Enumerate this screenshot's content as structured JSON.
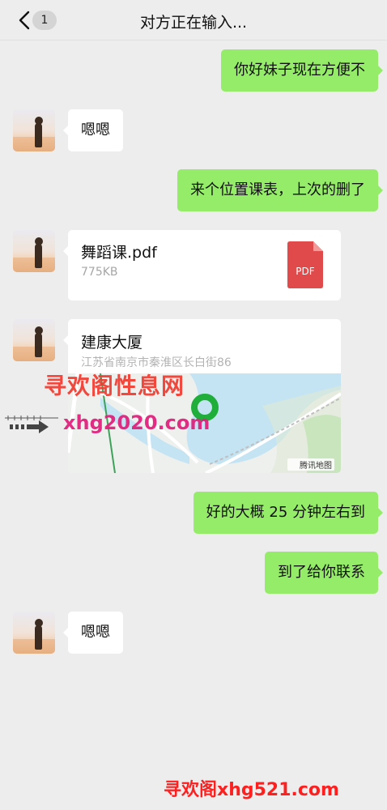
{
  "header": {
    "title": "对方正在输入...",
    "unread_count": "1"
  },
  "messages": [
    {
      "side": "right",
      "text": "你好妹子现在方便不"
    },
    {
      "side": "left",
      "text": "嗯嗯"
    },
    {
      "side": "right",
      "text": "来个位置课表，上次的删了"
    },
    {
      "side": "left",
      "type": "file",
      "name": "舞蹈课.pdf",
      "size": "775KB",
      "icon_label": "PDF"
    },
    {
      "side": "left",
      "type": "location",
      "name": "建康大厦",
      "address": "江苏省南京市秦淮区长白街86",
      "map_brand": "腾讯地图"
    },
    {
      "side": "right",
      "text": "好的大概 25 分钟左右到"
    },
    {
      "side": "right",
      "text": "到了给你联系"
    },
    {
      "side": "left",
      "text": "嗯嗯"
    }
  ],
  "watermarks": {
    "site_name": "寻欢阁性息网",
    "site_url": "xhg2020.com",
    "footer": "寻欢阁xhg521.com"
  },
  "colors": {
    "background": "#ededed",
    "bubble_right": "#95ec69",
    "bubble_left": "#ffffff",
    "pdf_red": "#e04a4a",
    "map_pin": "#1fae3a"
  }
}
